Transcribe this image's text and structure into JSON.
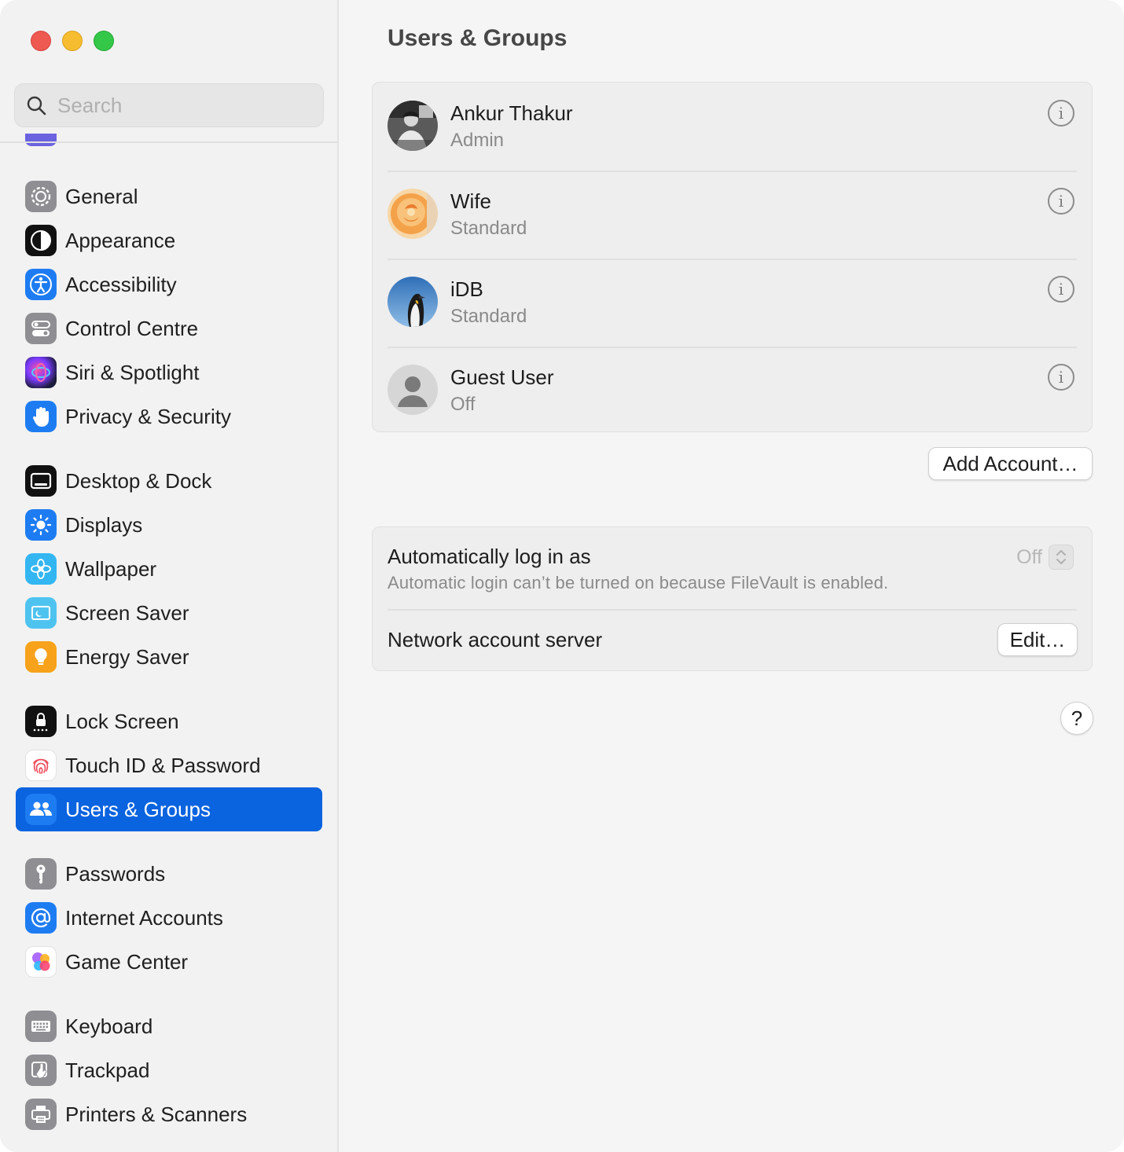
{
  "window": {
    "traffic_lights": [
      "close",
      "minimize",
      "zoom"
    ]
  },
  "sidebar": {
    "search": {
      "placeholder": "Search",
      "value": ""
    },
    "groups": [
      [
        {
          "label": "General",
          "icon": "gear-icon"
        },
        {
          "label": "Appearance",
          "icon": "appearance-icon"
        },
        {
          "label": "Accessibility",
          "icon": "accessibility-icon"
        },
        {
          "label": "Control Centre",
          "icon": "control-centre-icon"
        },
        {
          "label": "Siri & Spotlight",
          "icon": "siri-icon"
        },
        {
          "label": "Privacy & Security",
          "icon": "hand-icon"
        }
      ],
      [
        {
          "label": "Desktop & Dock",
          "icon": "dock-icon"
        },
        {
          "label": "Displays",
          "icon": "sun-icon"
        },
        {
          "label": "Wallpaper",
          "icon": "flower-icon"
        },
        {
          "label": "Screen Saver",
          "icon": "screen-saver-icon"
        },
        {
          "label": "Energy Saver",
          "icon": "bulb-icon"
        }
      ],
      [
        {
          "label": "Lock Screen",
          "icon": "lock-icon"
        },
        {
          "label": "Touch ID & Password",
          "icon": "fingerprint-icon"
        },
        {
          "label": "Users & Groups",
          "icon": "users-icon",
          "selected": true
        }
      ],
      [
        {
          "label": "Passwords",
          "icon": "key-icon"
        },
        {
          "label": "Internet Accounts",
          "icon": "at-icon"
        },
        {
          "label": "Game Center",
          "icon": "game-center-icon"
        }
      ],
      [
        {
          "label": "Keyboard",
          "icon": "keyboard-icon"
        },
        {
          "label": "Trackpad",
          "icon": "trackpad-icon"
        },
        {
          "label": "Printers & Scanners",
          "icon": "printer-icon"
        }
      ]
    ]
  },
  "main": {
    "title": "Users & Groups",
    "users": [
      {
        "name": "Ankur Thakur",
        "role": "Admin",
        "avatar": "photo-person-avatar"
      },
      {
        "name": "Wife",
        "role": "Standard",
        "avatar": "rose-avatar"
      },
      {
        "name": "iDB",
        "role": "Standard",
        "avatar": "penguin-avatar"
      },
      {
        "name": "Guest User",
        "role": "Off",
        "avatar": "generic-person-avatar"
      }
    ],
    "add_account_label": "Add Account…",
    "auto_login": {
      "label": "Automatically log in as",
      "note": "Automatic login can’t be turned on because FileVault is enabled.",
      "value": "Off"
    },
    "network_server": {
      "label": "Network account server",
      "button_label": "Edit…"
    },
    "help_label": "?"
  },
  "colors": {
    "selection": "#0a63df",
    "sidebar_bg": "#f2f2f2",
    "main_bg": "#f5f5f5",
    "card_bg": "#eeeeee"
  }
}
